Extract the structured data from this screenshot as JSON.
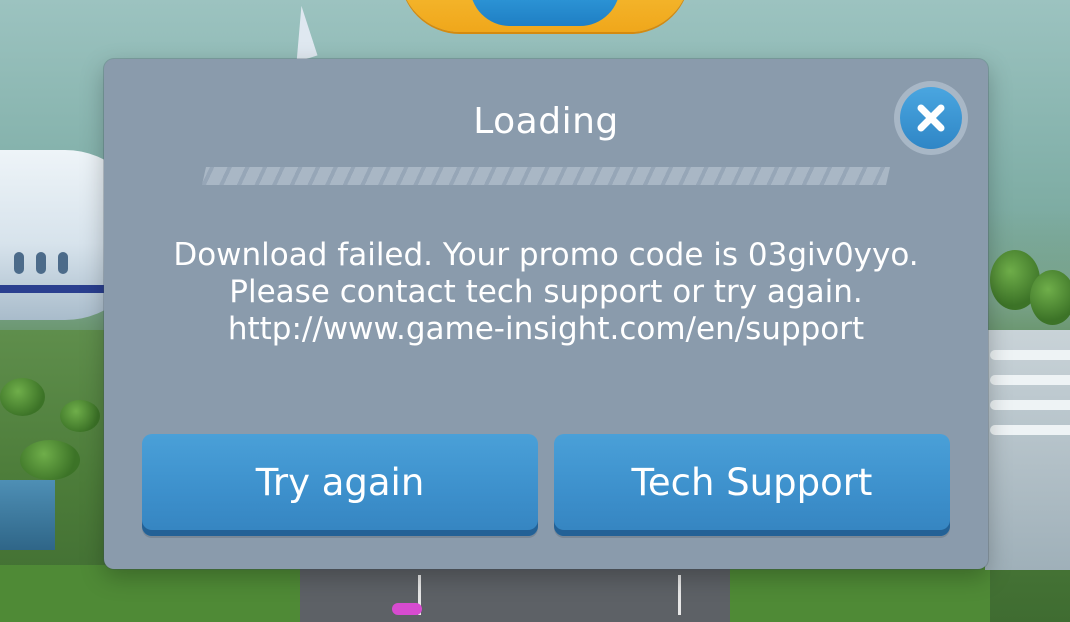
{
  "dialog": {
    "title": "Loading",
    "progress": 0,
    "message_lines": [
      "Download failed. Your promo code is 03giv0yyo.",
      "Please contact tech support or try again.",
      "http://www.game-insight.com/en/support"
    ],
    "buttons": {
      "try_again": "Try again",
      "tech_support": "Tech Support"
    },
    "close_icon": "close-icon"
  },
  "colors": {
    "dialog_bg": "#8a9bac",
    "button_blue": "#3c8fcb",
    "text": "#ffffff"
  }
}
